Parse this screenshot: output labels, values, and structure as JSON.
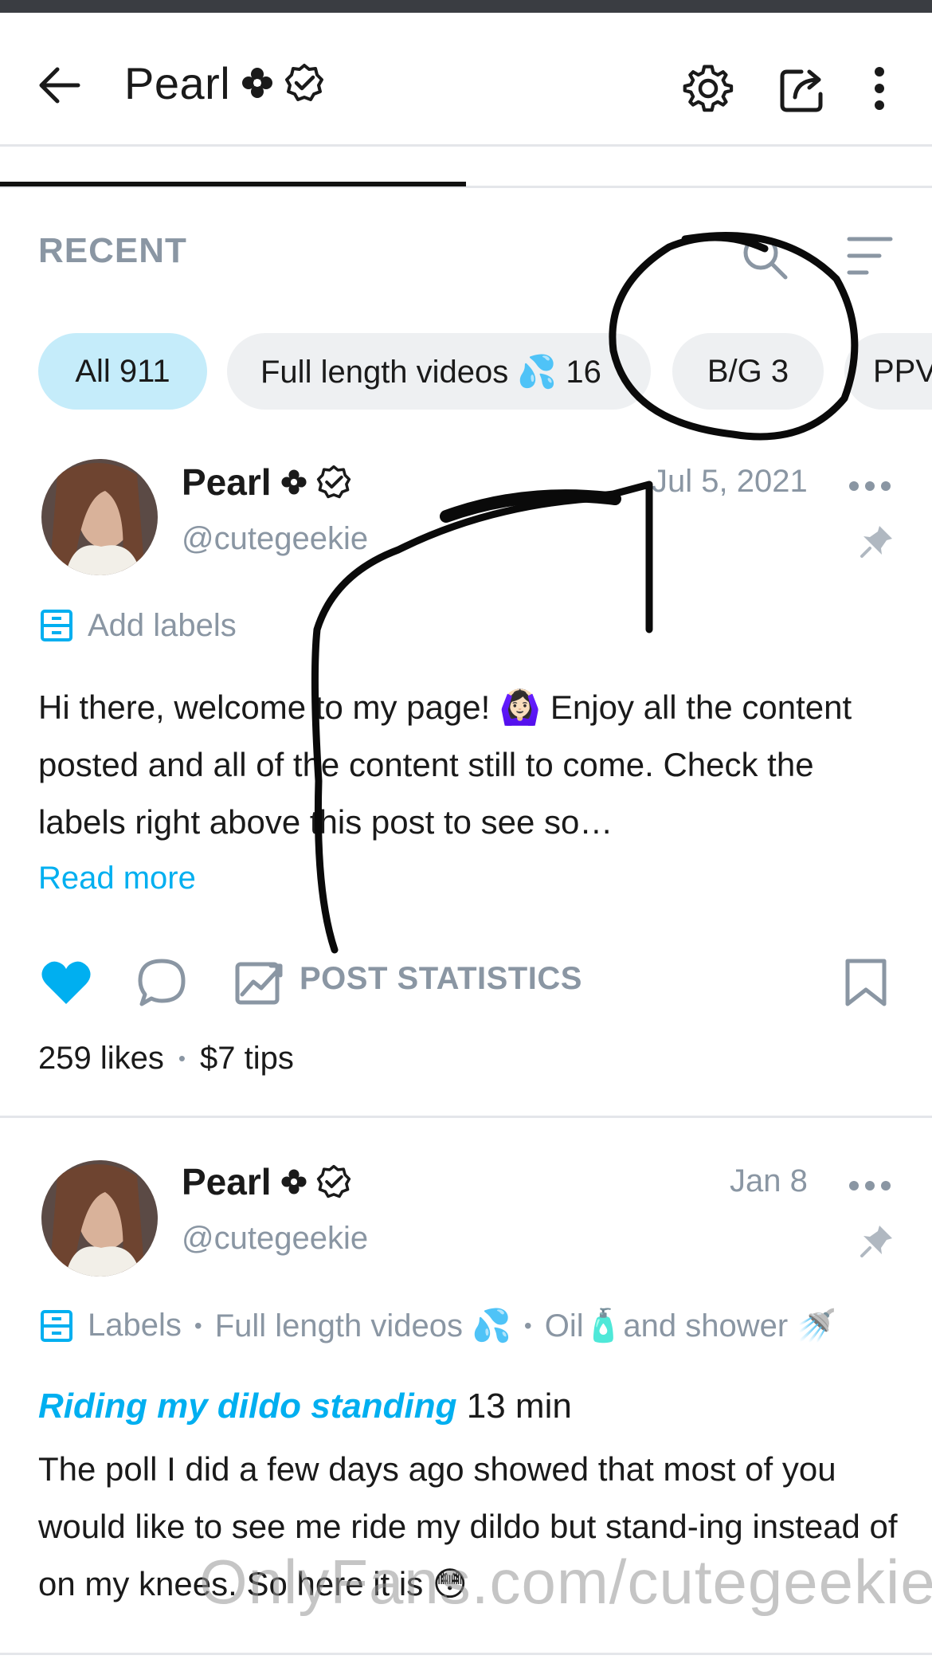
{
  "header": {
    "title": "Pearl",
    "icons": [
      "back-arrow-icon",
      "flower-icon",
      "verified-icon",
      "gear-icon",
      "share-icon",
      "more-vertical-icon"
    ]
  },
  "section": {
    "title": "RECENT"
  },
  "chips": [
    {
      "label": "All 911",
      "active": true
    },
    {
      "label": "Full length videos 💦 16",
      "active": false
    },
    {
      "label": "B/G 3",
      "active": false
    },
    {
      "label": "PPV",
      "active": false
    }
  ],
  "posts": [
    {
      "author": "Pearl",
      "handle": "@cutegeekie",
      "date": "Jul 5, 2021",
      "labels_text": "Add labels",
      "body": "Hi there, welcome to my page! 🙆🏻‍♀️ Enjoy all the content posted and all of the content still to come. Check the labels right above this post to see so…",
      "read_more": "Read more",
      "stats_label": "POST STATISTICS",
      "likes": "259 likes",
      "tips": "$7 tips"
    },
    {
      "author": "Pearl",
      "handle": "@cutegeekie",
      "date": "Jan 8",
      "labels_text": "Labels",
      "label_items": [
        "Full length videos 💦",
        "Oil🧴and shower 🚿"
      ],
      "title": "Riding my dildo standing",
      "duration": "13 min",
      "body": "The poll I did a few days ago showed that most of you would like to see me ride my dildo but stand-ing instead of on my knees. So here it is 😳"
    }
  ],
  "watermark": "OnlyFans.com/cutegeekie",
  "colors": {
    "accent": "#00aff0",
    "muted": "#8a96a3",
    "chip_active": "#c5ecfa",
    "chip": "#eef0f2"
  }
}
